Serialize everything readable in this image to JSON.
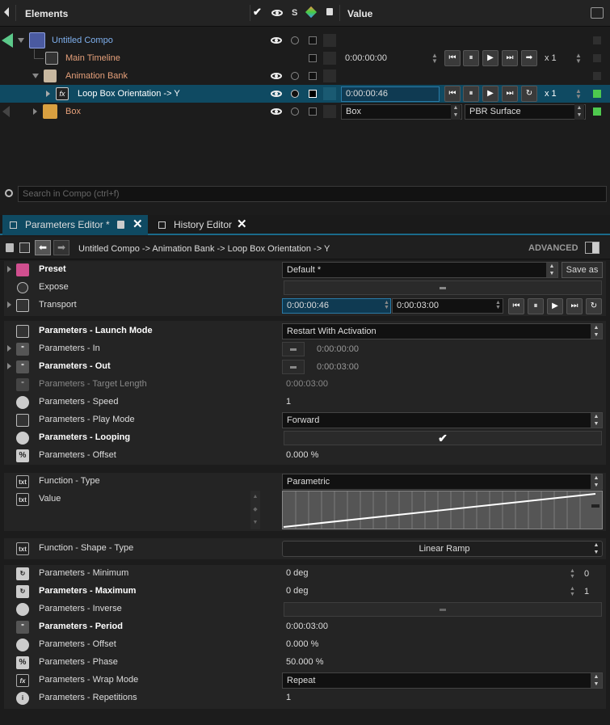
{
  "elements_header": {
    "title": "Elements",
    "s_label": "S",
    "value_label": "Value"
  },
  "tree": {
    "compo": {
      "label": "Untitled Compo"
    },
    "main_timeline": {
      "label": "Main Timeline",
      "time": "0:00:00:00",
      "repeat": "x 1"
    },
    "animation_bank": {
      "label": "Animation Bank"
    },
    "loop": {
      "label": "Loop Box Orientation -> Y",
      "time": "0:00:00:46",
      "repeat": "x 1"
    },
    "box": {
      "label": "Box",
      "field1": "Box",
      "field2": "PBR Surface"
    }
  },
  "search": {
    "placeholder": "Search in Compo (ctrl+f)"
  },
  "tabs": [
    {
      "label": "Parameters Editor *"
    },
    {
      "label": "History Editor"
    }
  ],
  "breadcrumb": {
    "text": "Untitled Compo -> Animation Bank -> Loop Box Orientation -> Y",
    "advanced": "ADVANCED"
  },
  "params": {
    "preset": {
      "label": "Preset",
      "value": "Default *",
      "save": "Save as"
    },
    "expose": {
      "label": "Expose"
    },
    "transport": {
      "label": "Transport",
      "current": "0:00:00:46",
      "duration": "0:00:03:00"
    },
    "launch_mode": {
      "label": "Parameters - Launch Mode",
      "value": "Restart With Activation"
    },
    "in": {
      "label": "Parameters - In",
      "value": "0:00:00:00"
    },
    "out": {
      "label": "Parameters - Out",
      "value": "0:00:03:00"
    },
    "target_length": {
      "label": "Parameters - Target Length",
      "value": "0:00:03:00"
    },
    "speed": {
      "label": "Parameters - Speed",
      "value": "1"
    },
    "play_mode": {
      "label": "Parameters - Play Mode",
      "value": "Forward"
    },
    "looping": {
      "label": "Parameters - Looping",
      "checked": true
    },
    "offset": {
      "label": "Parameters - Offset",
      "value": "0.000 %"
    },
    "function_type": {
      "label": "Function - Type",
      "value": "Parametric"
    },
    "value": {
      "label": "Value"
    },
    "shape_type": {
      "label": "Function - Shape - Type",
      "value": "Linear Ramp"
    },
    "minimum": {
      "label": "Parameters - Minimum",
      "value": "0 deg",
      "side": "0"
    },
    "maximum": {
      "label": "Parameters - Maximum",
      "value": "0 deg",
      "side": "1"
    },
    "inverse": {
      "label": "Parameters - Inverse"
    },
    "period": {
      "label": "Parameters - Period",
      "value": "0:00:03:00"
    },
    "offset2": {
      "label": "Parameters - Offset",
      "value": "0.000 %"
    },
    "phase": {
      "label": "Parameters - Phase",
      "value": "50.000 %"
    },
    "wrap_mode": {
      "label": "Parameters - Wrap Mode",
      "value": "Repeat"
    },
    "repetitions": {
      "label": "Parameters - Repetitions",
      "value": "1"
    }
  },
  "icons": {
    "txt": "txt",
    "fx": "fx",
    "pct": "%",
    "quote": "\""
  },
  "colors": {
    "selection": "#0f4a62",
    "accent_green": "#4ec94e",
    "orange_label": "#e6a07a",
    "blue_label": "#7fb0ee"
  }
}
